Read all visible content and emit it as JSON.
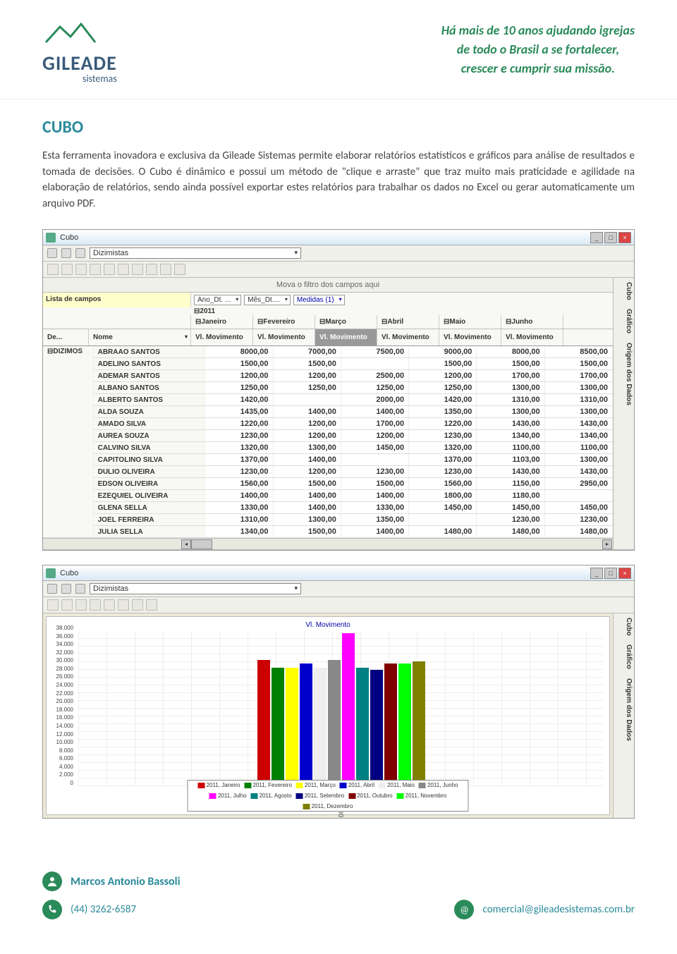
{
  "logo": {
    "main": "GILEADE",
    "sub": "sistemas"
  },
  "tagline": "Há mais de 10 anos ajudando igrejas\nde todo o Brasil a se fortalecer,\ncrescer e cumprir sua missão.",
  "title": "CUBO",
  "body": "Esta ferramenta inovadora e exclusiva da Gileade Sistemas permite elaborar relatórios estatísticos e gráficos para análise de resultados e tomada de decisões. O Cubo é dinâmico e possui um método de \"clique e arraste\" que traz muito mais praticidade e agilidade na elaboração de relatórios, sendo ainda possível exportar estes relatórios para trabalhar os dados no Excel ou gerar automaticamente um arquivo PDF.",
  "screenshot1": {
    "window_title": "Cubo",
    "dropdown": "Dizimistas",
    "filter_hint": "Mova o filtro dos campos aqui",
    "field_list_label": "Lista de campos",
    "col_dropdowns": [
      "Ano_Dt. ...",
      "Mês_Dt....",
      "Medidas (1)"
    ],
    "year": "⊟2011",
    "months": [
      "⊟Janeiro",
      "⊟Fevereiro",
      "⊟Março",
      "⊟Abril",
      "⊟Maio",
      "⊟Junho"
    ],
    "row_headers": {
      "de": "De...",
      "nome": "Nome",
      "measure": "Vl. Movimento"
    },
    "group": "⊟DIZIMOS",
    "side_tabs": [
      "Cubo",
      "Gráfico",
      "Origem dos Dados"
    ],
    "rows": [
      {
        "n": "ABRAAO SANTOS",
        "v": [
          "8000,00",
          "7000,00",
          "7500,00",
          "9000,00",
          "8000,00",
          "8500,00"
        ]
      },
      {
        "n": "ADELINO SANTOS",
        "v": [
          "1500,00",
          "1500,00",
          "",
          "1500,00",
          "1500,00",
          "1500,00"
        ]
      },
      {
        "n": "ADEMAR SANTOS",
        "v": [
          "1200,00",
          "1200,00",
          "2500,00",
          "1200,00",
          "1700,00",
          "1700,00"
        ]
      },
      {
        "n": "ALBANO SANTOS",
        "v": [
          "1250,00",
          "1250,00",
          "1250,00",
          "1250,00",
          "1300,00",
          "1300,00"
        ]
      },
      {
        "n": "ALBERTO SANTOS",
        "v": [
          "1420,00",
          "",
          "2000,00",
          "1420,00",
          "1310,00",
          "1310,00"
        ]
      },
      {
        "n": "ALDA SOUZA",
        "v": [
          "1435,00",
          "1400,00",
          "1400,00",
          "1350,00",
          "1300,00",
          "1300,00"
        ]
      },
      {
        "n": "AMADO SILVA",
        "v": [
          "1220,00",
          "1200,00",
          "1700,00",
          "1220,00",
          "1430,00",
          "1430,00"
        ]
      },
      {
        "n": "AUREA SOUZA",
        "v": [
          "1230,00",
          "1200,00",
          "1200,00",
          "1230,00",
          "1340,00",
          "1340,00"
        ]
      },
      {
        "n": "CALVINO SILVA",
        "v": [
          "1320,00",
          "1300,00",
          "1450,00",
          "1320,00",
          "1100,00",
          "1100,00"
        ]
      },
      {
        "n": "CAPITOLINO SILVA",
        "v": [
          "1370,00",
          "1400,00",
          "",
          "1370,00",
          "1103,00",
          "1300,00"
        ]
      },
      {
        "n": "DULIO OLIVEIRA",
        "v": [
          "1230,00",
          "1200,00",
          "1230,00",
          "1230,00",
          "1430,00",
          "1430,00"
        ]
      },
      {
        "n": "EDSON OLIVEIRA",
        "v": [
          "1560,00",
          "1500,00",
          "1500,00",
          "1560,00",
          "1150,00",
          "2950,00"
        ]
      },
      {
        "n": "EZEQUIEL OLIVEIRA",
        "v": [
          "1400,00",
          "1400,00",
          "1400,00",
          "1800,00",
          "1180,00",
          ""
        ]
      },
      {
        "n": "GLENA SELLA",
        "v": [
          "1330,00",
          "1400,00",
          "1330,00",
          "1450,00",
          "1450,00",
          "1450,00"
        ]
      },
      {
        "n": "JOEL FERREIRA",
        "v": [
          "1310,00",
          "1300,00",
          "1350,00",
          "",
          "1230,00",
          "1230,00"
        ]
      },
      {
        "n": "JULIA SELLA",
        "v": [
          "1340,00",
          "1500,00",
          "1400,00",
          "1480,00",
          "1480,00",
          "1480,00"
        ]
      }
    ]
  },
  "screenshot2": {
    "window_title": "Cubo",
    "dropdown": "Dizimistas",
    "chart_title": "Vl. Movimento",
    "xcat": "DIZIMOS",
    "side_tabs": [
      "Cubo",
      "Gráfico",
      "Origem dos Dados"
    ]
  },
  "chart_data": {
    "type": "bar",
    "title": "Vl. Movimento",
    "ylabel": "",
    "ylim": [
      0,
      38000
    ],
    "yticks": [
      0,
      2000,
      4000,
      6000,
      8000,
      10000,
      12000,
      14000,
      16000,
      18000,
      20000,
      22000,
      24000,
      26000,
      28000,
      30000,
      32000,
      34000,
      36000,
      38000
    ],
    "ytick_labels": [
      "0",
      "2.000",
      "4.000",
      "6.000",
      "8.000",
      "10.000",
      "12.000",
      "14.000",
      "16.000",
      "18.000",
      "20.000",
      "22.000",
      "24.000",
      "26.000",
      "28.000",
      "30.000",
      "32.000",
      "34.000",
      "36.000",
      "38.000"
    ],
    "categories": [
      "DIZIMOS"
    ],
    "series": [
      {
        "name": "2011, Janeiro",
        "color": "#cc0000",
        "values": [
          31000
        ]
      },
      {
        "name": "2011, Fevereiro",
        "color": "#008000",
        "values": [
          29000
        ]
      },
      {
        "name": "2011, Março",
        "color": "#ffff00",
        "values": [
          29000
        ]
      },
      {
        "name": "2011, Abril",
        "color": "#0000cc",
        "values": [
          30000
        ]
      },
      {
        "name": "2011, Maio",
        "color": "#eeeeee",
        "values": [
          29000
        ]
      },
      {
        "name": "2011, Junho",
        "color": "#888888",
        "values": [
          31000
        ]
      },
      {
        "name": "2011, Julho",
        "color": "#ff00ff",
        "values": [
          37500
        ]
      },
      {
        "name": "2011, Agosto",
        "color": "#008080",
        "values": [
          29000
        ]
      },
      {
        "name": "2011, Setembro",
        "color": "#000080",
        "values": [
          28500
        ]
      },
      {
        "name": "2011, Outubro",
        "color": "#800000",
        "values": [
          30000
        ]
      },
      {
        "name": "2011, Novembro",
        "color": "#00ff00",
        "values": [
          30000
        ]
      },
      {
        "name": "2011, Dezembro",
        "color": "#808000",
        "values": [
          30500
        ]
      }
    ]
  },
  "footer": {
    "name": "Marcos Antonio Bassoli",
    "phone": "(44) 3262-6587",
    "email": "comercial@gileadesistemas.com.br"
  }
}
